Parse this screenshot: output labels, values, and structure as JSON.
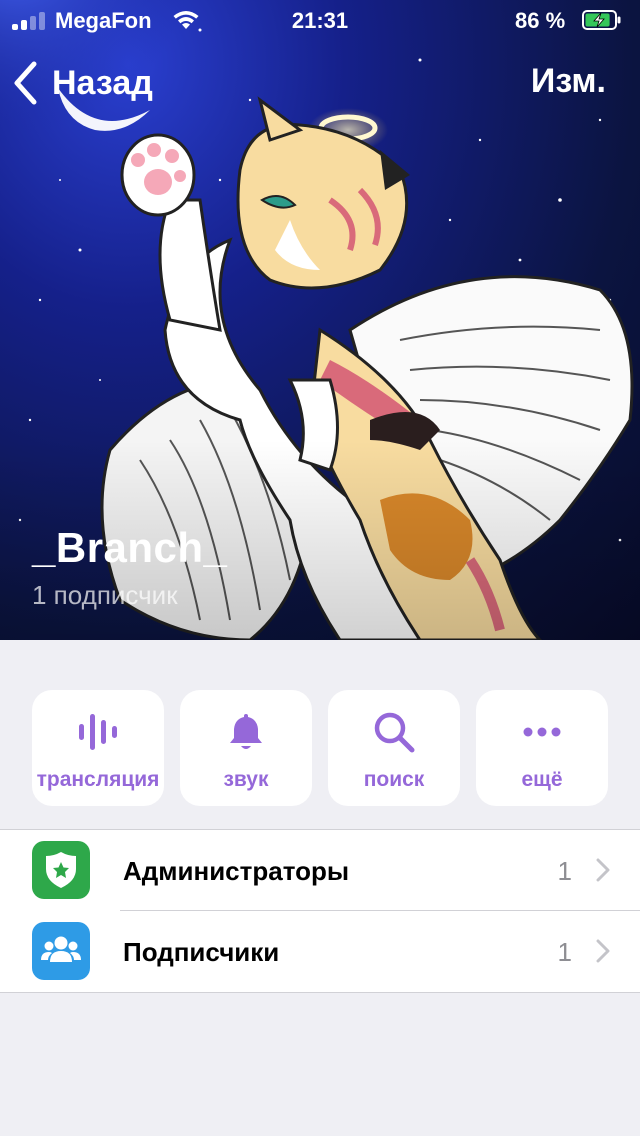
{
  "status_bar": {
    "carrier": "MegaFon",
    "time": "21:31",
    "battery_percent": "86 %",
    "battery_level": 0.86,
    "battery_charging": true,
    "signal_bars_filled": 2,
    "signal_bars_total": 4
  },
  "nav": {
    "back_label": "Назад",
    "edit_label": "Изм."
  },
  "channel": {
    "name": "_Branch_",
    "subscribers_text": "1 подписчик"
  },
  "actions": [
    {
      "label": "трансляция",
      "icon": "audio-waveform-icon"
    },
    {
      "label": "звук",
      "icon": "bell-icon"
    },
    {
      "label": "поиск",
      "icon": "search-icon"
    },
    {
      "label": "ещё",
      "icon": "more-dots-icon"
    }
  ],
  "list": {
    "rows": [
      {
        "label": "Администраторы",
        "count": "1",
        "icon": "shield-star-icon",
        "icon_color": "#2ea84a"
      },
      {
        "label": "Подписчики",
        "count": "1",
        "icon": "people-icon",
        "icon_color": "#2e9be6"
      }
    ]
  },
  "colors": {
    "accent": "#9568d9",
    "background": "#efeff4",
    "battery_green": "#34c759"
  }
}
